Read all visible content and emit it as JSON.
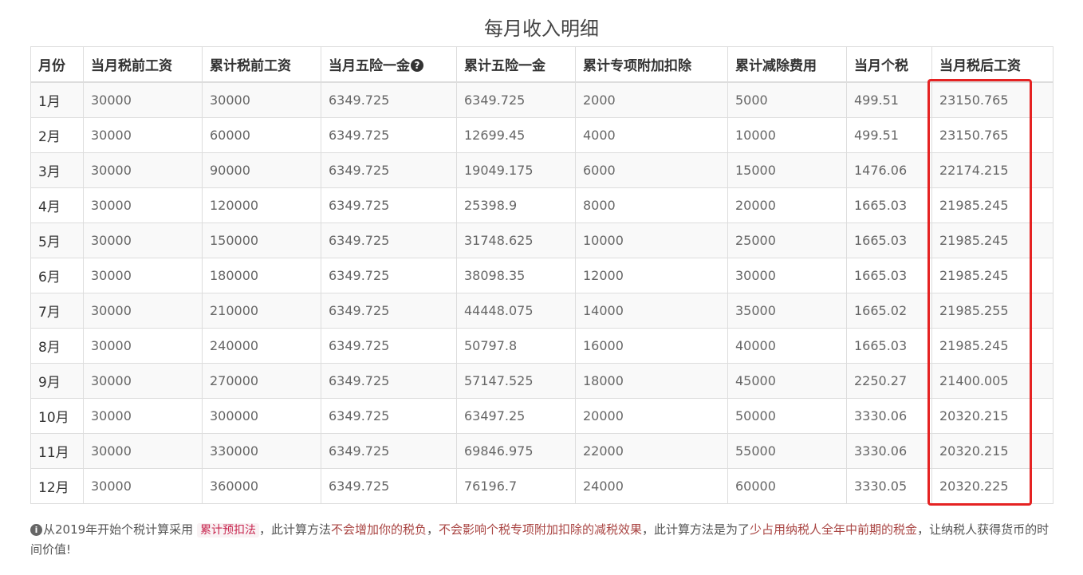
{
  "title": "每月收入明细",
  "table": {
    "headers": [
      "月份",
      "当月税前工资",
      "累计税前工资",
      "当月五险一金",
      "累计五险一金",
      "累计专项附加扣除",
      "累计减除费用",
      "当月个税",
      "当月税后工资"
    ],
    "help_icon_glyph": "?",
    "rows": [
      [
        "1月",
        "30000",
        "30000",
        "6349.725",
        "6349.725",
        "2000",
        "5000",
        "499.51",
        "23150.765"
      ],
      [
        "2月",
        "30000",
        "60000",
        "6349.725",
        "12699.45",
        "4000",
        "10000",
        "499.51",
        "23150.765"
      ],
      [
        "3月",
        "30000",
        "90000",
        "6349.725",
        "19049.175",
        "6000",
        "15000",
        "1476.06",
        "22174.215"
      ],
      [
        "4月",
        "30000",
        "120000",
        "6349.725",
        "25398.9",
        "8000",
        "20000",
        "1665.03",
        "21985.245"
      ],
      [
        "5月",
        "30000",
        "150000",
        "6349.725",
        "31748.625",
        "10000",
        "25000",
        "1665.03",
        "21985.245"
      ],
      [
        "6月",
        "30000",
        "180000",
        "6349.725",
        "38098.35",
        "12000",
        "30000",
        "1665.03",
        "21985.245"
      ],
      [
        "7月",
        "30000",
        "210000",
        "6349.725",
        "44448.075",
        "14000",
        "35000",
        "1665.02",
        "21985.255"
      ],
      [
        "8月",
        "30000",
        "240000",
        "6349.725",
        "50797.8",
        "16000",
        "40000",
        "1665.03",
        "21985.245"
      ],
      [
        "9月",
        "30000",
        "270000",
        "6349.725",
        "57147.525",
        "18000",
        "45000",
        "2250.27",
        "21400.005"
      ],
      [
        "10月",
        "30000",
        "300000",
        "6349.725",
        "63497.25",
        "20000",
        "50000",
        "3330.06",
        "20320.215"
      ],
      [
        "11月",
        "30000",
        "330000",
        "6349.725",
        "69846.975",
        "22000",
        "55000",
        "3330.06",
        "20320.215"
      ],
      [
        "12月",
        "30000",
        "360000",
        "6349.725",
        "76196.7",
        "24000",
        "60000",
        "3330.05",
        "20320.225"
      ]
    ]
  },
  "note": {
    "info_icon_glyph": "i",
    "part1": "从2019年开始个税计算采用",
    "code": "累计预扣法",
    "part2": "，此计算方法",
    "em1": "不会增加你的税负",
    "part3": "，",
    "em2": "不会影响个税专项附加扣除的减税效果",
    "part4": "，此计算方法是为了",
    "em3": "少占用纳税人全年中前期的税金",
    "part5": "，让纳税人获得货币的时间价值!"
  },
  "colors": {
    "highlight_border": "#e52222",
    "stripe": "#f9f9f9",
    "border": "#dddddd",
    "code_text": "#c7254e",
    "emphasis": "#a94442"
  }
}
